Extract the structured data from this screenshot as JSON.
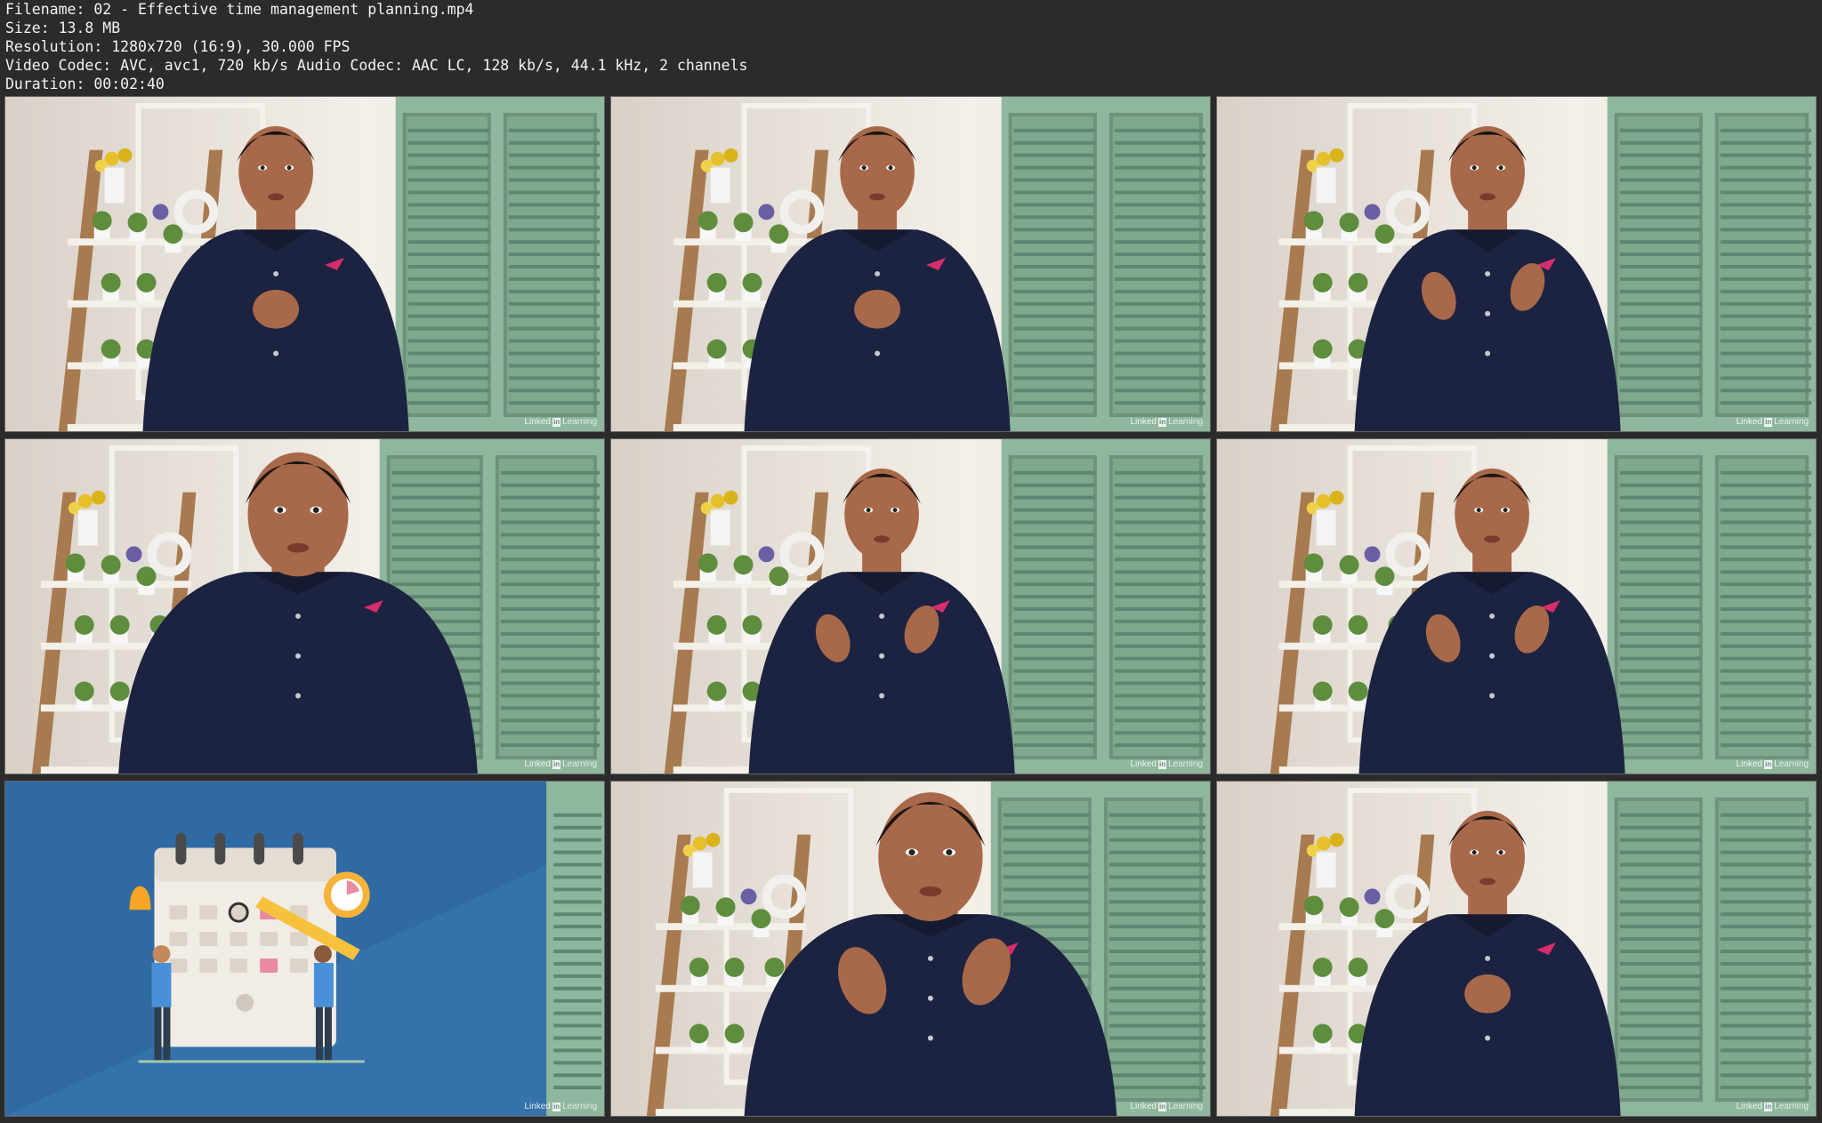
{
  "metadata": {
    "filename": "Filename: 02 - Effective time management planning.mp4",
    "size": "Size: 13.8 MB",
    "resolution": "Resolution: 1280x720 (16:9), 30.000 FPS",
    "codec": "Video Codec: AVC, avc1, 720 kb/s Audio Codec: AAC LC, 128 kb/s, 44.1 kHz, 2 channels",
    "duration": "Duration: 00:02:40"
  },
  "watermark": {
    "brand": "Linked",
    "badge": "in",
    "suffix": "Learning"
  },
  "colors": {
    "background": "#2b2b2b",
    "wall": "#e7e1da",
    "shutter": "#8fb79e",
    "suit": "#1c2340",
    "skin": "#a8694a",
    "slide_blue": "#2f6aa3"
  },
  "thumbnails": [
    {
      "scene": "presenter-hands-clasped"
    },
    {
      "scene": "presenter-hands-clasped"
    },
    {
      "scene": "presenter-gesturing"
    },
    {
      "scene": "presenter-closeup"
    },
    {
      "scene": "presenter-gesturing"
    },
    {
      "scene": "presenter-gesturing"
    },
    {
      "scene": "calendar-illustration"
    },
    {
      "scene": "presenter-closeup"
    },
    {
      "scene": "presenter-hands-clasped"
    }
  ]
}
